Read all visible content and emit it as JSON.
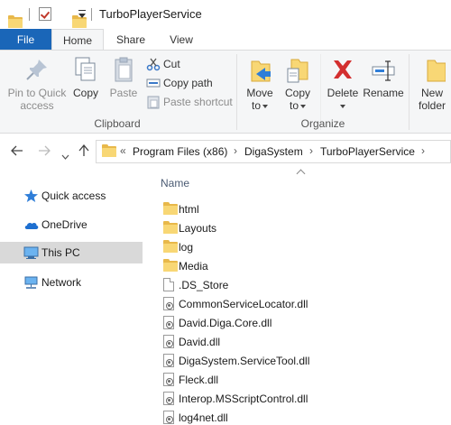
{
  "window": {
    "title": "TurboPlayerService"
  },
  "tabs": [
    {
      "label": "File"
    },
    {
      "label": "Home"
    },
    {
      "label": "Share"
    },
    {
      "label": "View"
    }
  ],
  "ribbon": {
    "clipboard": {
      "pin_line1": "Pin to Quick",
      "pin_line2": "access",
      "copy": "Copy",
      "paste": "Paste",
      "cut": "Cut",
      "copy_path": "Copy path",
      "paste_shortcut": "Paste shortcut",
      "group_label": "Clipboard"
    },
    "organize": {
      "move_line1": "Move",
      "move_line2": "to",
      "copy_line1": "Copy",
      "copy_line2": "to",
      "delete": "Delete",
      "rename": "Rename",
      "group_label": "Organize"
    },
    "new": {
      "new_line1": "New",
      "new_line2": "folder"
    }
  },
  "address": {
    "overflow": "«",
    "crumbs": [
      "Program Files (x86)",
      "DigaSystem",
      "TurboPlayerService"
    ]
  },
  "navpane": {
    "items": [
      {
        "label": "Quick access",
        "icon": "star-icon"
      },
      {
        "label": "OneDrive",
        "icon": "cloud-icon"
      },
      {
        "label": "This PC",
        "icon": "computer-icon",
        "selected": true
      },
      {
        "label": "Network",
        "icon": "network-icon"
      }
    ]
  },
  "filelist": {
    "column_name": "Name",
    "items": [
      {
        "name": "html",
        "type": "folder"
      },
      {
        "name": "Layouts",
        "type": "folder"
      },
      {
        "name": "log",
        "type": "folder"
      },
      {
        "name": "Media",
        "type": "folder"
      },
      {
        "name": ".DS_Store",
        "type": "file"
      },
      {
        "name": "CommonServiceLocator.dll",
        "type": "dll"
      },
      {
        "name": "David.Diga.Core.dll",
        "type": "dll"
      },
      {
        "name": "David.dll",
        "type": "dll"
      },
      {
        "name": "DigaSystem.ServiceTool.dll",
        "type": "dll"
      },
      {
        "name": "Fleck.dll",
        "type": "dll"
      },
      {
        "name": "Interop.MSScriptControl.dll",
        "type": "dll"
      },
      {
        "name": "log4net.dll",
        "type": "dll"
      }
    ]
  },
  "colors": {
    "file_tab": "#1a66b8",
    "folder": "#f8d775",
    "selected_nav": "#d9d9d9",
    "delete_red": "#d32f2f",
    "move_blue": "#2f7ed8"
  }
}
